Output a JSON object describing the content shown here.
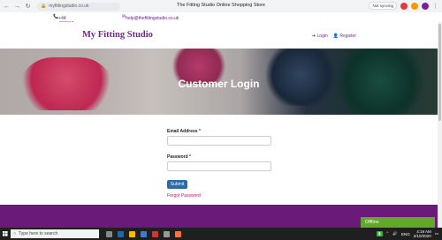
{
  "browser": {
    "url": "myfittingstudio.co.uk",
    "tab_title": "The Fitting Studio Online Shopping Store",
    "sync_chip": "Not syncing"
  },
  "contact": {
    "phone": "+44 (0)8613 0038",
    "email": "help@thefittingstudio.co.uk"
  },
  "header": {
    "brand": "My Fitting Studio",
    "login": "Login",
    "register": "Register"
  },
  "hero": {
    "title": "Customer Login"
  },
  "form": {
    "email_label": "Email Address",
    "password_label": "Password",
    "required_mark": "*",
    "submit_label": "Submit",
    "forgot_label": "Forgot Password"
  },
  "status": {
    "offline": "Offline"
  },
  "taskbar": {
    "search_placeholder": "Type here to search",
    "lang": "ENG",
    "time": "4:19 AM",
    "date": "2/10/2020"
  },
  "colors": {
    "brand": "#6b2c8f",
    "footer": "#6a1b7a",
    "submit": "#2d6ba8",
    "offline": "#62a62a"
  }
}
